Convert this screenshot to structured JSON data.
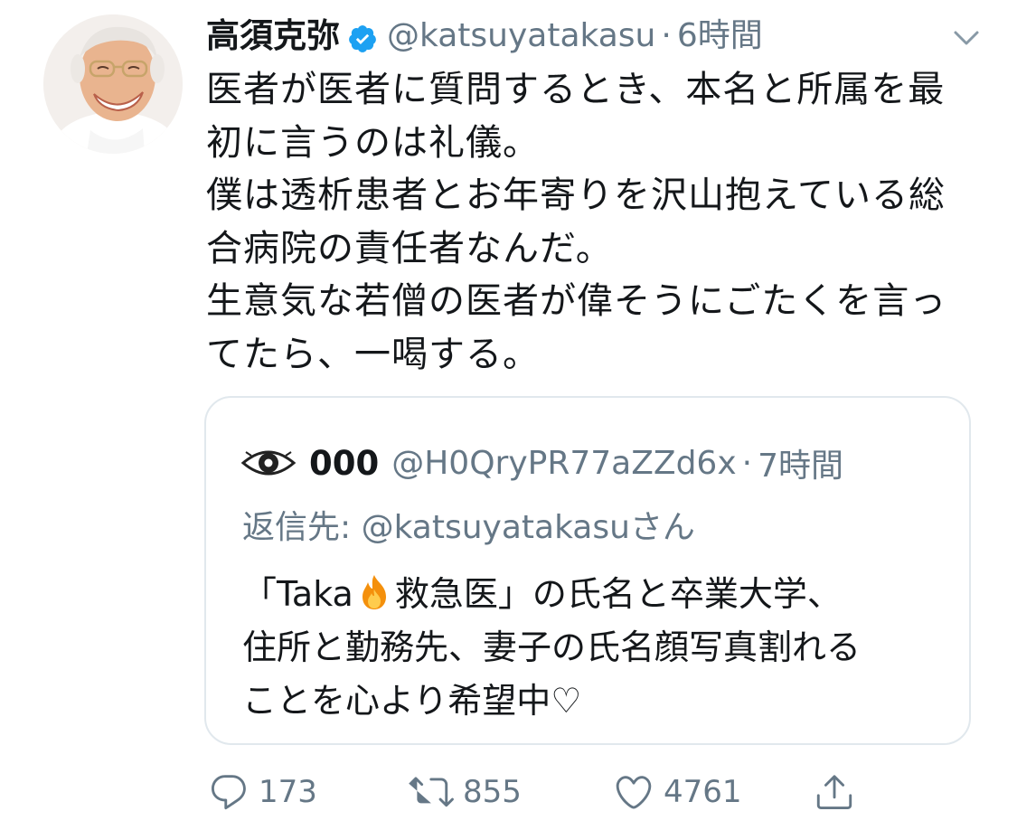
{
  "tweet": {
    "display_name": "高須克弥",
    "handle": "@katsuyatakasu",
    "separator": "·",
    "time": "6時間",
    "text": "医者が医者に質問するとき、本名と所属を最\n初に言うのは礼儀。\n僕は透析患者とお年寄りを沢山抱えている総\n合病院の責任者なんだ。\n生意気な若僧の医者が偉そうにごたくを言っ\nてたら、一喝する。"
  },
  "quote": {
    "display_name": "000",
    "handle": "@H0QryPR77aZZd6x",
    "separator": "·",
    "time": "7時間",
    "reply_to": "返信先: @katsuyatakasuさん",
    "text_before_emoji": "「Taka",
    "text_after_emoji": "救急医」の氏名と卒業大学、\n住所と勤務先、妻子の氏名顔写真割れる\nことを心より希望中♡"
  },
  "actions": {
    "replies": "173",
    "retweets": "855",
    "likes": "4761"
  },
  "icons": {
    "verified": "verified-badge-icon",
    "caret": "chevron-down-icon",
    "quote_avatar": "eye-icon",
    "emoji": "fire-emoji",
    "reply": "reply-icon",
    "retweet": "retweet-icon",
    "like": "heart-icon",
    "share": "share-icon"
  },
  "colors": {
    "text": "#14171a",
    "secondary": "#657786",
    "verified": "#1da1f2",
    "border": "#e1e8ed"
  }
}
